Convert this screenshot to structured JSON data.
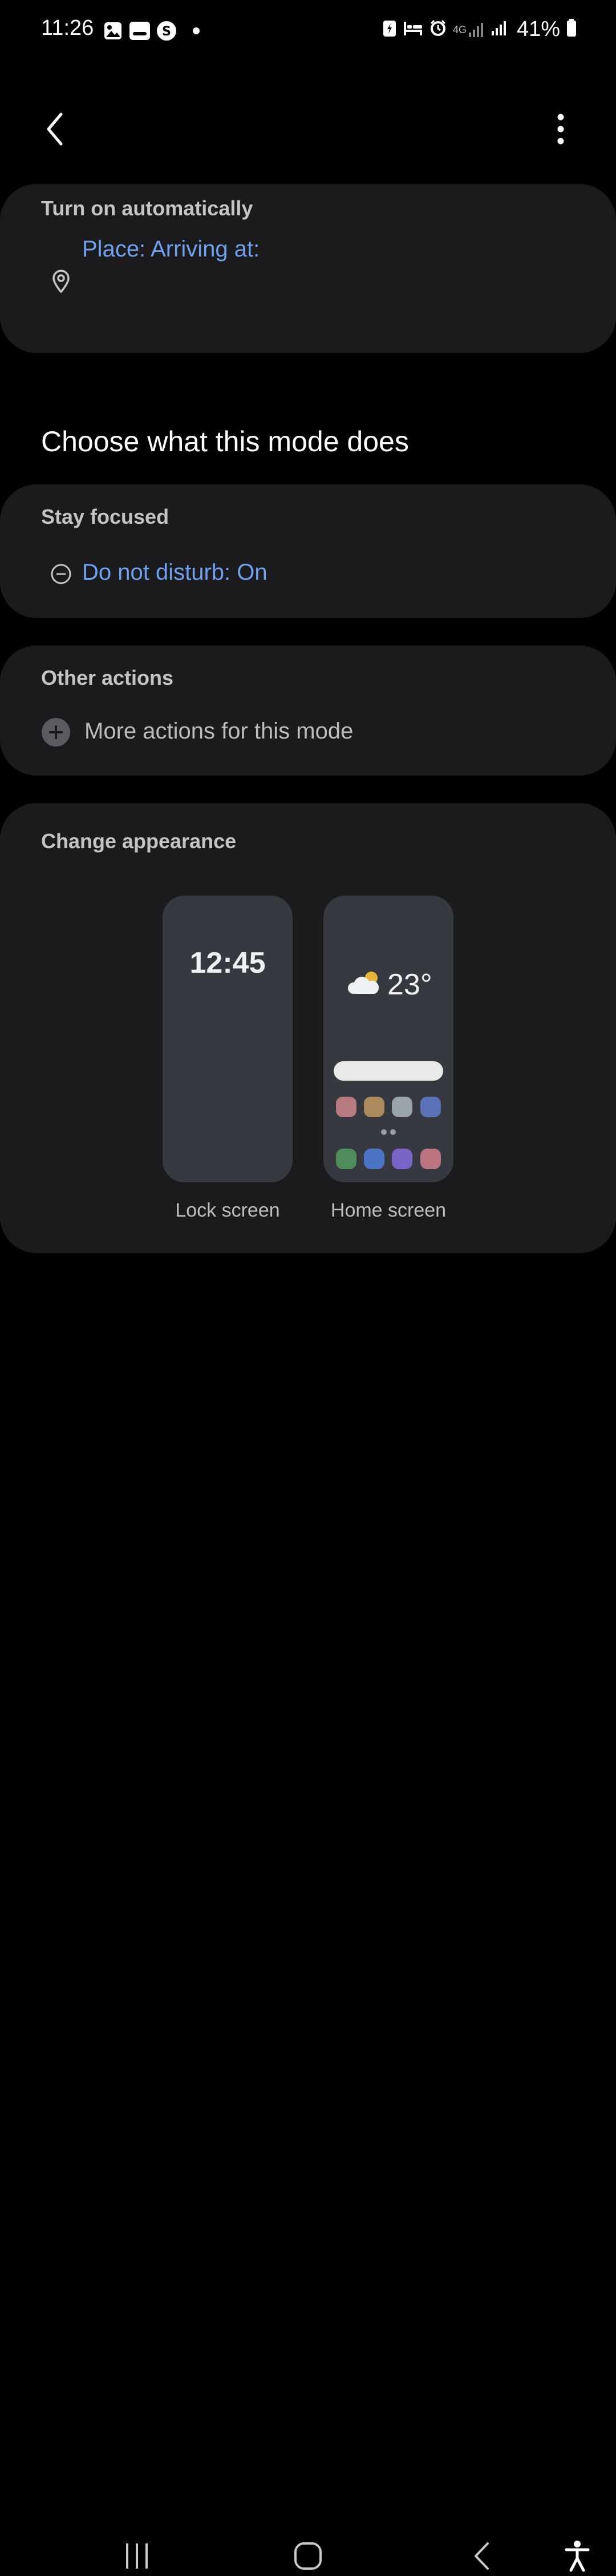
{
  "status_bar": {
    "time": "11:26",
    "battery": "41%",
    "network": "4G",
    "left_icons": [
      "gallery-icon",
      "media-icon",
      "samsung-pay-icon",
      "notification-dot-icon"
    ],
    "right_icons": [
      "battery-saver-icon",
      "sleep-icon",
      "alarm-icon",
      "signal-4g-icon",
      "signal-icon",
      "signal-icon",
      "battery-icon"
    ]
  },
  "app_bar": {
    "back_icon": "chevron-left-icon",
    "more_icon": "more-vert-icon"
  },
  "turn_on": {
    "title": "Turn on automatically",
    "place_label": "Place: Arriving at:",
    "icon": "location-pin-icon"
  },
  "mode_section": {
    "heading": "Choose what this mode does"
  },
  "stay_focused": {
    "title": "Stay focused",
    "dnd_label": "Do not disturb: On",
    "icon": "minus-circle-icon"
  },
  "other_actions": {
    "title": "Other actions",
    "more_label": "More actions for this mode",
    "icon": "add-circle-icon"
  },
  "appearance": {
    "title": "Change appearance",
    "lock_time": "12:45",
    "lock_label": "Lock screen",
    "temperature": "23°",
    "home_label": "Home screen",
    "weather_icon": "partly-cloudy-icon",
    "app_colors_row1": [
      "#b77a7f",
      "#ad8a5e",
      "#9aa5ab",
      "#5c72b8"
    ],
    "app_colors_row2": [
      "#4e8c5c",
      "#4b74c4",
      "#7a63c7",
      "#bb7480"
    ]
  },
  "colors": {
    "accent": "#6fa1ef",
    "card": "#1b1b1d",
    "background": "#000000"
  },
  "nav_bar": {
    "icons": [
      "recents-icon",
      "home-icon",
      "back-icon",
      "accessibility-icon"
    ]
  }
}
